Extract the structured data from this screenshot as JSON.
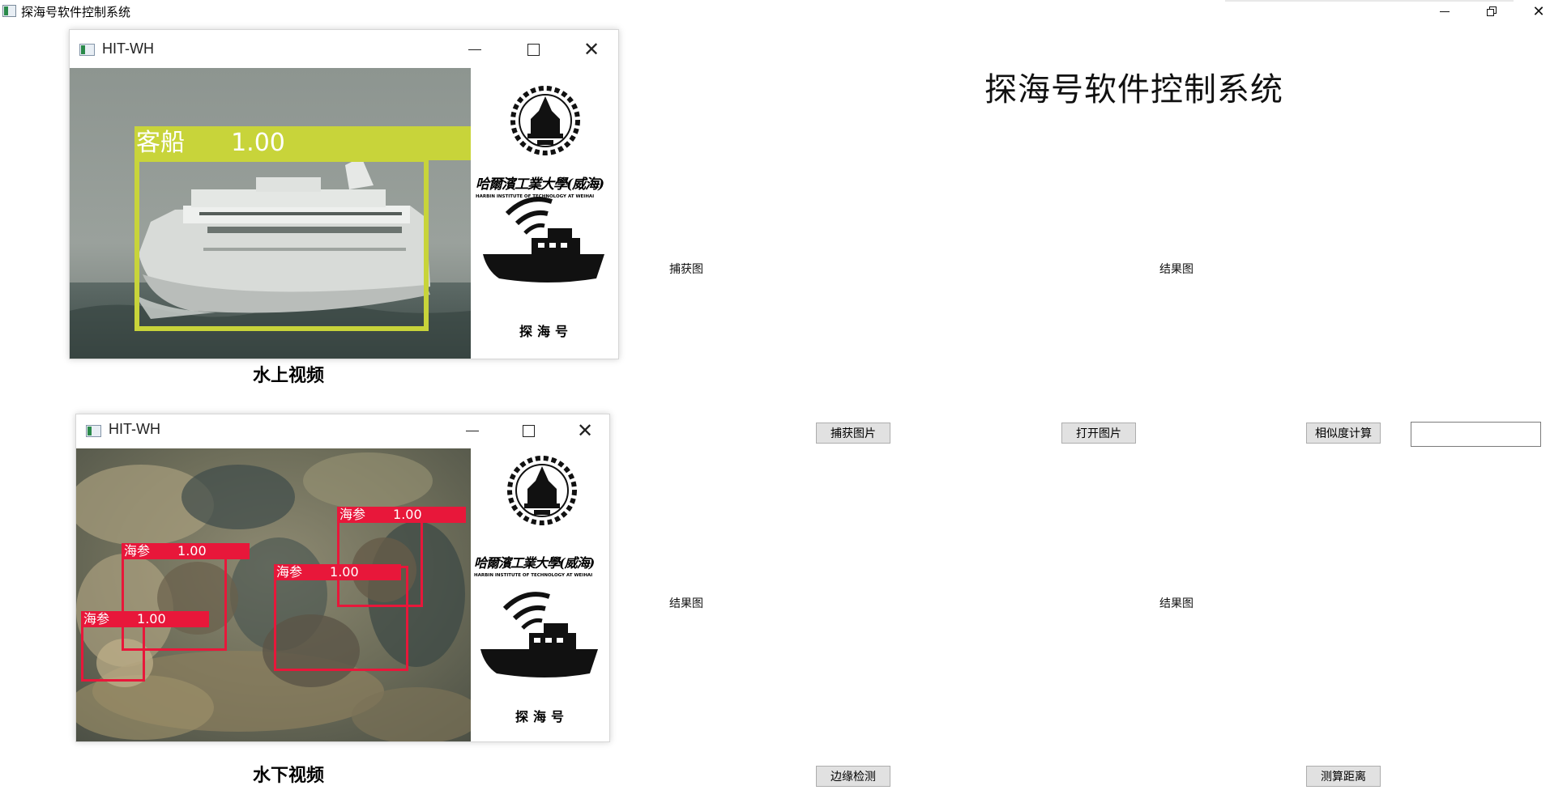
{
  "window": {
    "title": "探海号软件控制系统"
  },
  "heading": "探海号软件控制系统",
  "video_windows": [
    {
      "title": "HIT-WH",
      "caption": "水上视频",
      "detections": [
        {
          "label": "客船",
          "score": "1.00",
          "color": "#c8d43a"
        }
      ]
    },
    {
      "title": "HIT-WH",
      "caption": "水下视频",
      "detections": [
        {
          "label": "海参",
          "score": "1.00",
          "color": "#e8173a"
        },
        {
          "label": "海参",
          "score": "1.00",
          "color": "#e8173a"
        },
        {
          "label": "海参",
          "score": "1.00",
          "color": "#e8173a"
        },
        {
          "label": "海参",
          "score": "1.00",
          "color": "#e8173a"
        }
      ]
    }
  ],
  "logo": {
    "university_cn": "哈爾濱工業大學(威海)",
    "university_en": "HARBIN INSTITUTE OF TECHNOLOGY AT WEIHAI",
    "brand": "探海号"
  },
  "panels": {
    "capture_label": "捕获图",
    "result_label_1": "结果图",
    "result_label_2": "结果图",
    "result_label_3": "结果图"
  },
  "buttons": {
    "capture": "捕获图片",
    "open": "打开图片",
    "similarity": "相似度计算",
    "edge": "边缘检测",
    "distance": "测算距离"
  },
  "similarity_output": {
    "value": ""
  },
  "colors": {
    "ship_box": "#c8d43a",
    "cucumber_box": "#e8173a",
    "button_bg": "#e1e1e1"
  }
}
